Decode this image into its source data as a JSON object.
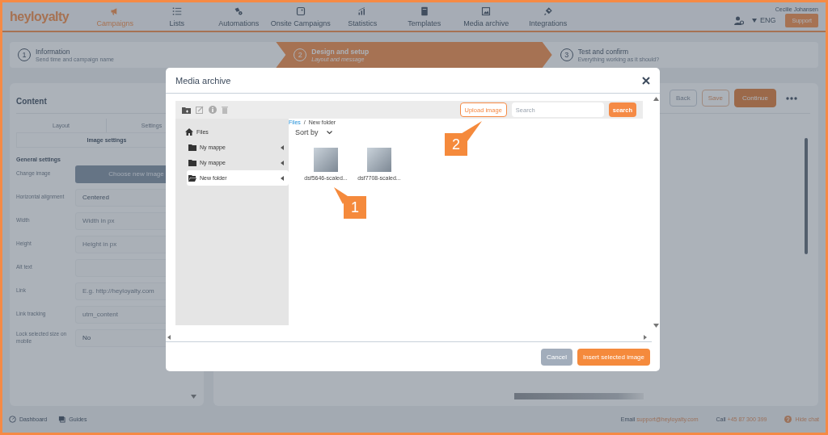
{
  "nav": {
    "logo": "heyloyalty",
    "items": [
      {
        "label": "Campaigns",
        "selected": true
      },
      {
        "label": "Lists",
        "selected": false
      },
      {
        "label": "Automations",
        "selected": false
      },
      {
        "label": "Onsite Campaigns",
        "selected": false
      },
      {
        "label": "Statistics",
        "selected": false
      },
      {
        "label": "Templates",
        "selected": false
      },
      {
        "label": "Media archive",
        "selected": false
      },
      {
        "label": "Integrations",
        "selected": false
      }
    ],
    "user_name": "Cecilie Johansen",
    "language": "ENG",
    "support": "Support"
  },
  "steps": [
    {
      "number": "1",
      "title": "Information",
      "subtitle": "Send time and campaign name",
      "selected": false
    },
    {
      "number": "2",
      "title": "Design and setup",
      "subtitle": "Layout and message",
      "selected": true
    },
    {
      "number": "3",
      "title": "Test and confirm",
      "subtitle": "Everything working as it should?",
      "selected": false
    }
  ],
  "content_panel": {
    "title": "Content",
    "tabs": [
      "Layout",
      "Settings"
    ],
    "subtab": "Image settings",
    "section": "General settings",
    "rows": [
      {
        "label": "Change image",
        "kind": "button",
        "text": "Choose new image"
      },
      {
        "label": "Horizontal alignment",
        "kind": "value",
        "text": "Centered"
      },
      {
        "label": "Width",
        "kind": "placeholder",
        "text": "Width in px"
      },
      {
        "label": "Height",
        "kind": "placeholder",
        "text": "Height in px"
      },
      {
        "label": "Alt text",
        "kind": "placeholder"
      },
      {
        "label": "Link",
        "kind": "placeholder",
        "text": "E.g. http://heyloyalty.com"
      },
      {
        "label": "Link tracking",
        "kind": "placeholder",
        "text": "utm_content"
      },
      {
        "label": "Lock selected size on mobile",
        "kind": "value",
        "text": "No"
      }
    ]
  },
  "preview_panel": {
    "buttons": [
      {
        "label": "Back",
        "kind": "plain"
      },
      {
        "label": "Save",
        "kind": "outline"
      },
      {
        "label": "Continue",
        "kind": "primary"
      }
    ]
  },
  "footer": {
    "links": [
      "Dashboard",
      "Guides"
    ],
    "email_label": "Email",
    "email": "support@heyloyalty.com",
    "call_label": "Call",
    "phone": "+45 87 300 399",
    "hide_chat": "Hide chat"
  },
  "modal": {
    "title": "Media archive",
    "upload": "Upload image",
    "search_placeholder": "Search",
    "search_button": "search",
    "breadcrumb": {
      "items": [
        "Files",
        "New folder"
      ],
      "separator": "/"
    },
    "sort": "Sort by",
    "tree": {
      "label": "Files",
      "children": [
        {
          "label": "Ny mappe",
          "selected": false
        },
        {
          "label": "Ny mappe",
          "selected": false
        },
        {
          "label": "New folder",
          "selected": true
        }
      ]
    },
    "files": [
      {
        "name": "dsf5646-scaled..."
      },
      {
        "name": "dsf7708-scaled..."
      }
    ],
    "cancel": "Cancel",
    "insert": "Insert selected image"
  },
  "callouts": [
    {
      "label": "1"
    },
    {
      "label": "2"
    }
  ]
}
